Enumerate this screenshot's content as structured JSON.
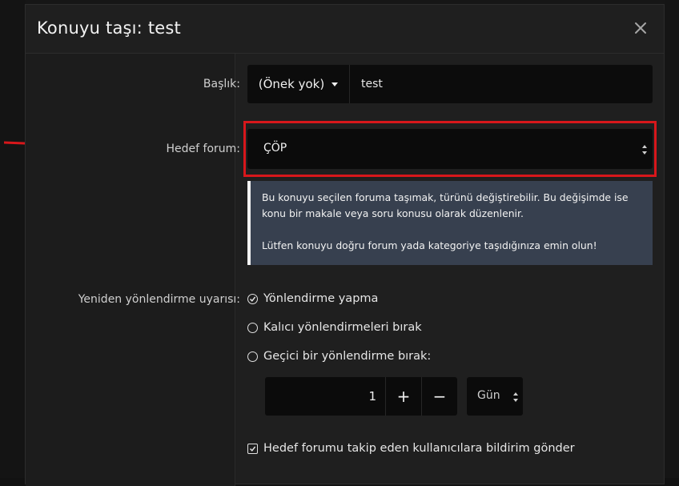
{
  "dialog": {
    "title": "Konuyu taşı: test"
  },
  "fields": {
    "title_label": "Başlık:",
    "prefix_button": "(Önek yok)",
    "title_value": "test",
    "target_forum_label": "Hedef forum:",
    "target_forum_value": "ÇÖP",
    "redirect_label": "Yeniden yönlendirme uyarısı:"
  },
  "info": {
    "line1": "Bu konuyu seçilen foruma taşımak, türünü değiştirebilir. Bu değişimde ise konu bir makale veya soru konusu olarak düzenlenir.",
    "line2": "Lütfen konuyu doğru forum yada kategoriye taşıdığınıza emin olun!"
  },
  "redirect_options": [
    {
      "label": "Yönlendirme yapma",
      "selected": true
    },
    {
      "label": "Kalıcı yönlendirmeleri bırak",
      "selected": false
    },
    {
      "label": "Geçici bir yönlendirme bırak:",
      "selected": false
    }
  ],
  "temp_redirect": {
    "amount": "1",
    "plus": "+",
    "minus": "−",
    "unit": "Gün"
  },
  "notify": {
    "label": "Hedef forumu takip eden kullanıcılara bildirim gönder",
    "checked": true
  },
  "colors": {
    "highlight": "#d7171b",
    "info_bg": "#37404f"
  }
}
